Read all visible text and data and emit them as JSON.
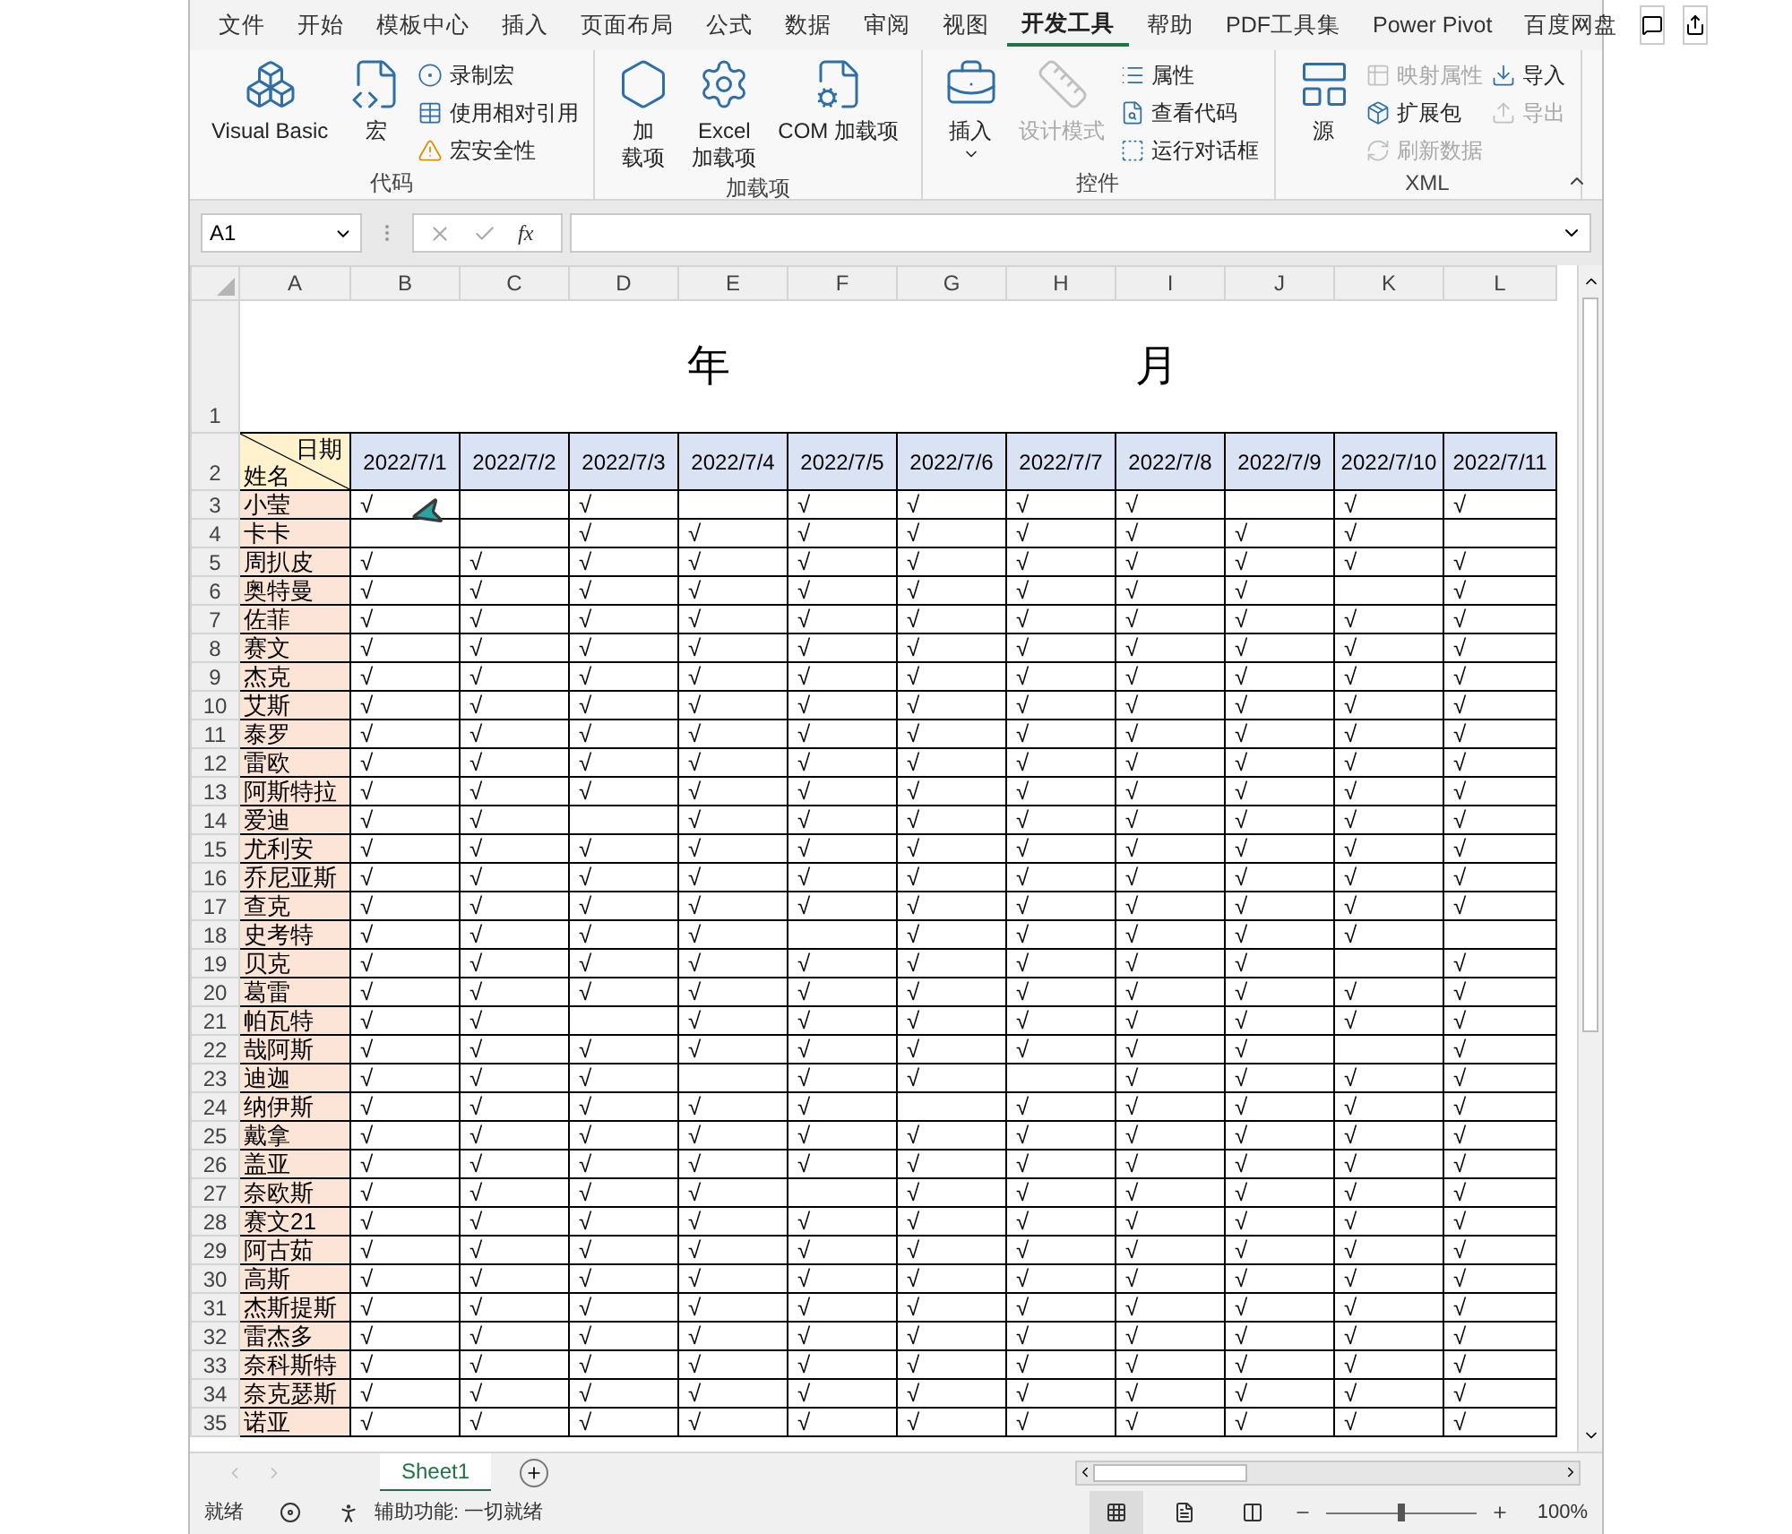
{
  "ribbon_tabs": [
    {
      "label": "文件",
      "selected": false
    },
    {
      "label": "开始",
      "selected": false
    },
    {
      "label": "模板中心",
      "selected": false
    },
    {
      "label": "插入",
      "selected": false
    },
    {
      "label": "页面布局",
      "selected": false
    },
    {
      "label": "公式",
      "selected": false
    },
    {
      "label": "数据",
      "selected": false
    },
    {
      "label": "审阅",
      "selected": false
    },
    {
      "label": "视图",
      "selected": false
    },
    {
      "label": "开发工具",
      "selected": true
    },
    {
      "label": "帮助",
      "selected": false
    },
    {
      "label": "PDF工具集",
      "selected": false
    },
    {
      "label": "Power Pivot",
      "selected": false
    },
    {
      "label": "百度网盘",
      "selected": false
    }
  ],
  "ribbon_groups": [
    {
      "label": "代码",
      "items": [
        {
          "kind": "large",
          "label": "Visual Basic",
          "disabled": false
        },
        {
          "kind": "large",
          "label": "宏",
          "disabled": false
        },
        {
          "kind": "small",
          "label": "录制宏",
          "disabled": false
        },
        {
          "kind": "small",
          "label": "使用相对引用",
          "disabled": false
        },
        {
          "kind": "small",
          "label": "宏安全性",
          "disabled": false
        }
      ]
    },
    {
      "label": "加载项",
      "items": [
        {
          "kind": "large",
          "label": "加载项",
          "disabled": false,
          "narrow": true
        },
        {
          "kind": "large",
          "label": "Excel\n加载项",
          "disabled": false
        },
        {
          "kind": "large",
          "label": "COM 加载项",
          "disabled": false
        }
      ]
    },
    {
      "label": "控件",
      "items": [
        {
          "kind": "large",
          "label": "插入",
          "disabled": false,
          "dropdown": true
        },
        {
          "kind": "large",
          "label": "设计模式",
          "disabled": true
        },
        {
          "kind": "small",
          "label": "属性",
          "disabled": false
        },
        {
          "kind": "small",
          "label": "查看代码",
          "disabled": false
        },
        {
          "kind": "small",
          "label": "运行对话框",
          "disabled": false
        }
      ]
    },
    {
      "label": "XML",
      "items": [
        {
          "kind": "large",
          "label": "源",
          "disabled": false
        },
        {
          "kind": "small",
          "label": "映射属性",
          "disabled": true
        },
        {
          "kind": "small",
          "label": "扩展包",
          "disabled": false
        },
        {
          "kind": "small",
          "label": "刷新数据",
          "disabled": true
        },
        {
          "kind": "small",
          "label": "导入",
          "disabled": false
        },
        {
          "kind": "small",
          "label": "导出",
          "disabled": true
        }
      ]
    }
  ],
  "formula_bar": {
    "name_box": "A1",
    "function_button": "fx"
  },
  "column_bar": {
    "letters": [
      "A",
      "B",
      "C",
      "D",
      "E",
      "F",
      "G",
      "H",
      "I",
      "J",
      "K",
      "L"
    ]
  },
  "sheet": {
    "title_row": {
      "number": "1",
      "year": "年",
      "month": "月"
    },
    "header_row": {
      "number": "2",
      "corner_top": "日期",
      "corner_bottom": "姓名",
      "dates": [
        "2022/7/1",
        "2022/7/2",
        "2022/7/3",
        "2022/7/4",
        "2022/7/5",
        "2022/7/6",
        "2022/7/7",
        "2022/7/8",
        "2022/7/9",
        "2022/7/10",
        "2022/7/11"
      ]
    },
    "rows": [
      {
        "number": "3",
        "name": "小莹",
        "cells": [
          "√",
          null,
          "√",
          null,
          "√",
          "√",
          "√",
          "√",
          null,
          "√",
          "√"
        ]
      },
      {
        "number": "4",
        "name": "卡卡",
        "cells": [
          null,
          null,
          "√",
          "√",
          "√",
          "√",
          "√",
          "√",
          "√",
          "√",
          null
        ]
      },
      {
        "number": "5",
        "name": "周扒皮",
        "cells": [
          "√",
          "√",
          "√",
          "√",
          "√",
          "√",
          "√",
          "√",
          "√",
          "√",
          "√"
        ]
      },
      {
        "number": "6",
        "name": "奥特曼",
        "cells": [
          "√",
          "√",
          "√",
          "√",
          "√",
          "√",
          "√",
          "√",
          "√",
          null,
          "√"
        ]
      },
      {
        "number": "7",
        "name": "佐菲",
        "cells": [
          "√",
          "√",
          "√",
          "√",
          "√",
          "√",
          "√",
          "√",
          "√",
          "√",
          "√"
        ]
      },
      {
        "number": "8",
        "name": "赛文",
        "cells": [
          "√",
          "√",
          "√",
          "√",
          "√",
          "√",
          "√",
          "√",
          "√",
          "√",
          "√"
        ]
      },
      {
        "number": "9",
        "name": "杰克",
        "cells": [
          "√",
          "√",
          "√",
          "√",
          "√",
          "√",
          "√",
          "√",
          "√",
          "√",
          "√"
        ]
      },
      {
        "number": "10",
        "name": "艾斯",
        "cells": [
          "√",
          "√",
          "√",
          "√",
          "√",
          "√",
          "√",
          "√",
          "√",
          "√",
          "√"
        ]
      },
      {
        "number": "11",
        "name": "泰罗",
        "cells": [
          "√",
          "√",
          "√",
          "√",
          "√",
          "√",
          "√",
          "√",
          "√",
          "√",
          "√"
        ]
      },
      {
        "number": "12",
        "name": "雷欧",
        "cells": [
          "√",
          "√",
          "√",
          "√",
          "√",
          "√",
          "√",
          "√",
          "√",
          "√",
          "√"
        ]
      },
      {
        "number": "13",
        "name": "阿斯特拉",
        "cells": [
          "√",
          "√",
          "√",
          "√",
          "√",
          "√",
          "√",
          "√",
          "√",
          "√",
          "√"
        ]
      },
      {
        "number": "14",
        "name": "爱迪",
        "cells": [
          "√",
          "√",
          null,
          "√",
          "√",
          "√",
          "√",
          "√",
          "√",
          "√",
          "√"
        ]
      },
      {
        "number": "15",
        "name": "尤利安",
        "cells": [
          "√",
          "√",
          "√",
          "√",
          "√",
          "√",
          "√",
          "√",
          "√",
          "√",
          "√"
        ]
      },
      {
        "number": "16",
        "name": "乔尼亚斯",
        "cells": [
          "√",
          "√",
          "√",
          "√",
          "√",
          "√",
          "√",
          "√",
          "√",
          "√",
          "√"
        ]
      },
      {
        "number": "17",
        "name": "查克",
        "cells": [
          "√",
          "√",
          "√",
          "√",
          "√",
          "√",
          "√",
          "√",
          "√",
          "√",
          "√"
        ]
      },
      {
        "number": "18",
        "name": "史考特",
        "cells": [
          "√",
          "√",
          "√",
          "√",
          null,
          "√",
          "√",
          "√",
          "√",
          "√",
          null
        ]
      },
      {
        "number": "19",
        "name": "贝克",
        "cells": [
          "√",
          "√",
          "√",
          "√",
          "√",
          "√",
          "√",
          "√",
          "√",
          null,
          "√"
        ]
      },
      {
        "number": "20",
        "name": "葛雷",
        "cells": [
          "√",
          "√",
          "√",
          "√",
          "√",
          "√",
          "√",
          "√",
          "√",
          "√",
          "√"
        ]
      },
      {
        "number": "21",
        "name": "帕瓦特",
        "cells": [
          "√",
          "√",
          null,
          "√",
          "√",
          "√",
          "√",
          "√",
          "√",
          "√",
          "√"
        ]
      },
      {
        "number": "22",
        "name": "哉阿斯",
        "cells": [
          "√",
          "√",
          "√",
          "√",
          "√",
          "√",
          "√",
          "√",
          "√",
          null,
          "√"
        ]
      },
      {
        "number": "23",
        "name": "迪迦",
        "cells": [
          "√",
          "√",
          "√",
          null,
          "√",
          "√",
          null,
          "√",
          "√",
          "√",
          "√"
        ]
      },
      {
        "number": "24",
        "name": "纳伊斯",
        "cells": [
          "√",
          "√",
          "√",
          "√",
          "√",
          null,
          "√",
          "√",
          "√",
          "√",
          "√"
        ]
      },
      {
        "number": "25",
        "name": "戴拿",
        "cells": [
          "√",
          "√",
          "√",
          "√",
          "√",
          "√",
          "√",
          "√",
          "√",
          "√",
          "√"
        ]
      },
      {
        "number": "26",
        "name": "盖亚",
        "cells": [
          "√",
          "√",
          "√",
          "√",
          "√",
          "√",
          "√",
          "√",
          "√",
          "√",
          "√"
        ]
      },
      {
        "number": "27",
        "name": "奈欧斯",
        "cells": [
          "√",
          "√",
          "√",
          "√",
          null,
          "√",
          "√",
          "√",
          "√",
          "√",
          "√"
        ]
      },
      {
        "number": "28",
        "name": "赛文21",
        "cells": [
          "√",
          "√",
          "√",
          "√",
          "√",
          "√",
          "√",
          "√",
          "√",
          "√",
          "√"
        ]
      },
      {
        "number": "29",
        "name": "阿古茹",
        "cells": [
          "√",
          "√",
          "√",
          "√",
          "√",
          "√",
          "√",
          "√",
          "√",
          "√",
          "√"
        ]
      },
      {
        "number": "30",
        "name": "高斯",
        "cells": [
          "√",
          "√",
          "√",
          "√",
          "√",
          "√",
          "√",
          "√",
          "√",
          "√",
          "√"
        ]
      },
      {
        "number": "31",
        "name": "杰斯提斯",
        "cells": [
          "√",
          "√",
          "√",
          "√",
          "√",
          "√",
          "√",
          "√",
          "√",
          "√",
          "√"
        ]
      },
      {
        "number": "32",
        "name": "雷杰多",
        "cells": [
          "√",
          "√",
          "√",
          "√",
          "√",
          "√",
          "√",
          "√",
          "√",
          "√",
          "√"
        ]
      },
      {
        "number": "33",
        "name": "奈科斯特",
        "cells": [
          "√",
          "√",
          "√",
          "√",
          "√",
          "√",
          "√",
          "√",
          "√",
          "√",
          "√"
        ]
      },
      {
        "number": "34",
        "name": "奈克瑟斯",
        "cells": [
          "√",
          "√",
          "√",
          "√",
          "√",
          "√",
          "√",
          "√",
          "√",
          "√",
          "√"
        ]
      },
      {
        "number": "35",
        "name": "诺亚",
        "cells": [
          "√",
          "√",
          "√",
          "√",
          "√",
          "√",
          "√",
          "√",
          "√",
          "√",
          "√"
        ]
      }
    ]
  },
  "sheet_tabs": [
    {
      "label": "Sheet1",
      "selected": true
    }
  ],
  "status_bar": {
    "ready": "就绪",
    "accessibility": "辅助功能: 一切就绪",
    "zoom": "100%",
    "zoom_slider": {
      "level": 0.5
    }
  }
}
